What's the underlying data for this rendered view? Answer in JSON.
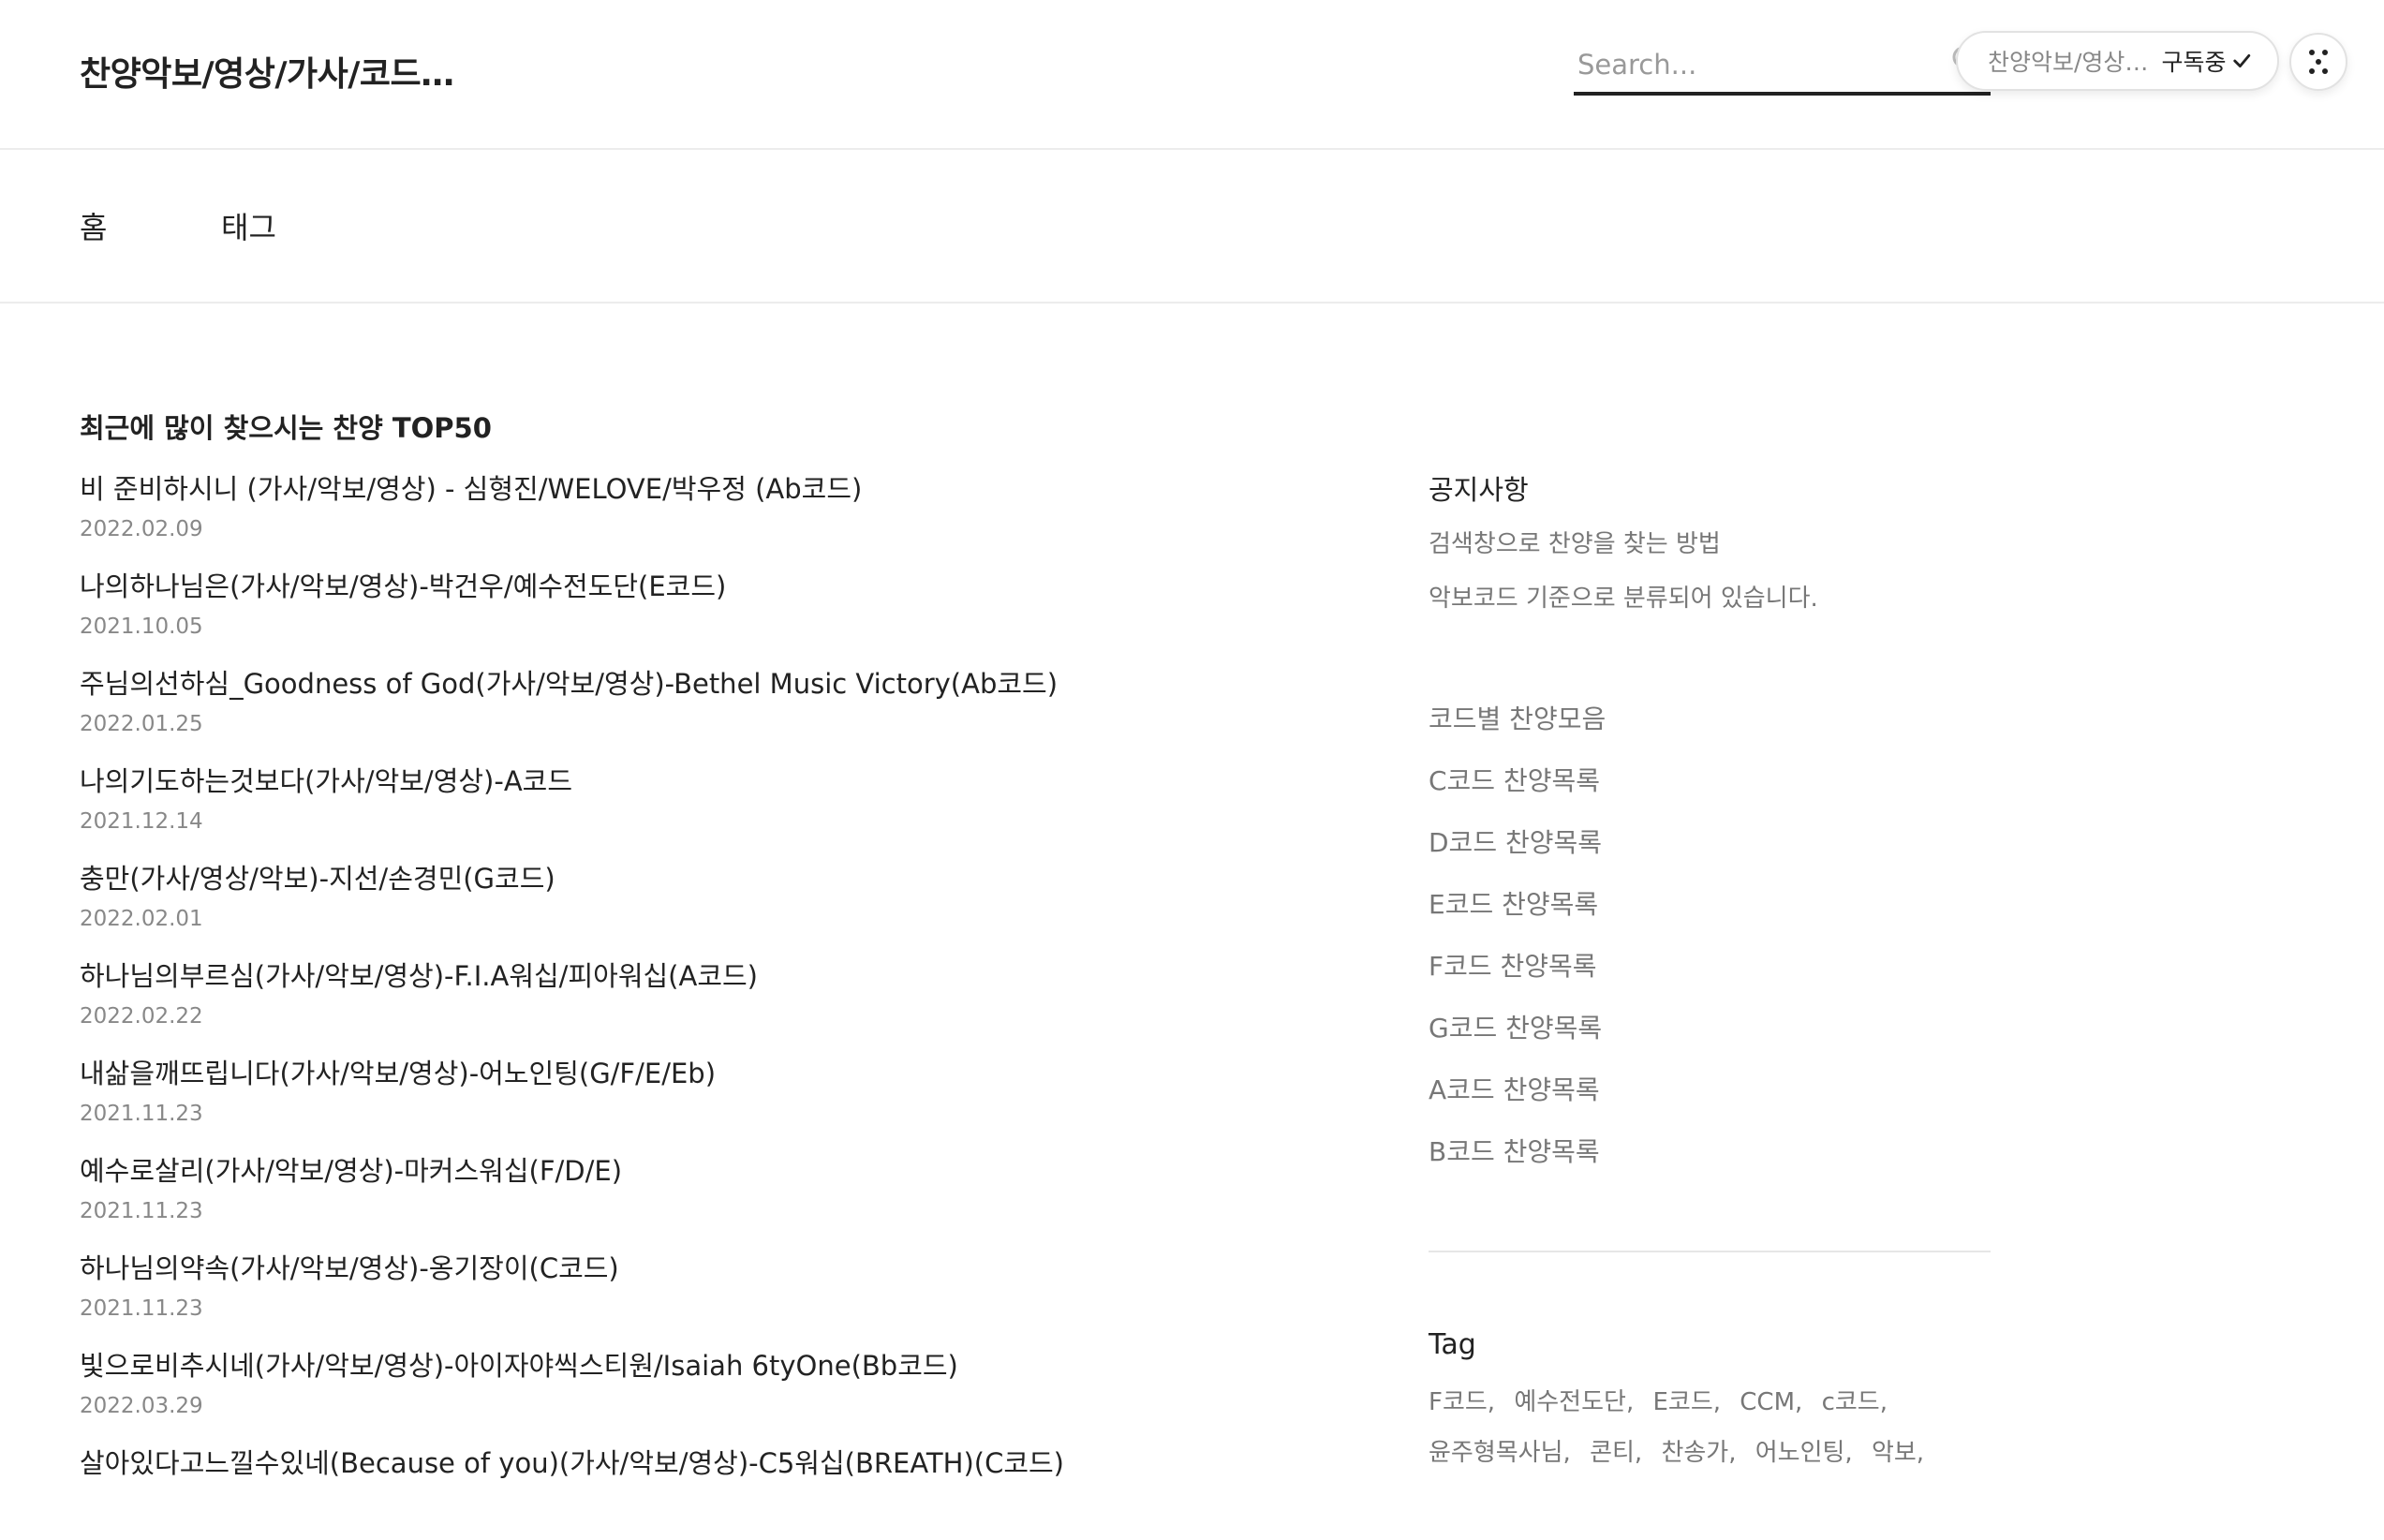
{
  "header": {
    "site_title": "찬양악보/영상/가사/코드…",
    "search_placeholder": "Search...",
    "subscribe_blog": "찬양악보/영상…",
    "subscribe_state": "구독중"
  },
  "nav": {
    "items": [
      {
        "label": "홈"
      },
      {
        "label": "태그"
      }
    ]
  },
  "main": {
    "section_title": "최근에 많이 찾으시는 찬양 TOP50",
    "posts": [
      {
        "title": "비 준비하시니 (가사/악보/영상) - 심형진/WELOVE/박우정 (Ab코드)",
        "date": "2022.02.09"
      },
      {
        "title": "나의하나님은(가사/악보/영상)-박건우/예수전도단(E코드)",
        "date": "2021.10.05"
      },
      {
        "title": "주님의선하심_Goodness of God(가사/악보/영상)-Bethel Music Victory(Ab코드)",
        "date": "2022.01.25"
      },
      {
        "title": "나의기도하는것보다(가사/악보/영상)-A코드",
        "date": "2021.12.14"
      },
      {
        "title": "충만(가사/영상/악보)-지선/손경민(G코드)",
        "date": "2022.02.01"
      },
      {
        "title": "하나님의부르심(가사/악보/영상)-F.I.A워십/피아워십(A코드)",
        "date": "2022.02.22"
      },
      {
        "title": "내삶을깨뜨립니다(가사/악보/영상)-어노인팅(G/F/E/Eb)",
        "date": "2021.11.23"
      },
      {
        "title": "예수로살리(가사/악보/영상)-마커스워십(F/D/E)",
        "date": "2021.11.23"
      },
      {
        "title": "하나님의약속(가사/악보/영상)-옹기장이(C코드)",
        "date": "2021.11.23"
      },
      {
        "title": "빛으로비추시네(가사/악보/영상)-아이자야씩스티원/Isaiah 6tyOne(Bb코드)",
        "date": "2022.03.29"
      },
      {
        "title": "살아있다고느낄수있네(Because of you)(가사/악보/영상)-C5워십(BREATH)(C코드)",
        "date": ""
      }
    ]
  },
  "sidebar": {
    "notice_heading": "공지사항",
    "notices": [
      "검색창으로 찬양을 찾는 방법",
      "악보코드 기준으로 분류되어 있습니다."
    ],
    "categories": [
      "코드별 찬양모음",
      "C코드 찬양목록",
      "D코드 찬양목록",
      "E코드 찬양목록",
      "F코드 찬양목록",
      "G코드 찬양목록",
      "A코드 찬양목록",
      "B코드 찬양목록"
    ],
    "tag_heading": "Tag",
    "tags_row1": [
      "F코드",
      "예수전도단",
      "E코드",
      "CCM",
      "c코드"
    ],
    "tags_row2": [
      "윤주형목사님",
      "콘티",
      "찬송가",
      "어노인팅",
      "악보"
    ]
  },
  "colors": {
    "text": "#222222",
    "muted": "#888888",
    "divider": "#ececec"
  }
}
